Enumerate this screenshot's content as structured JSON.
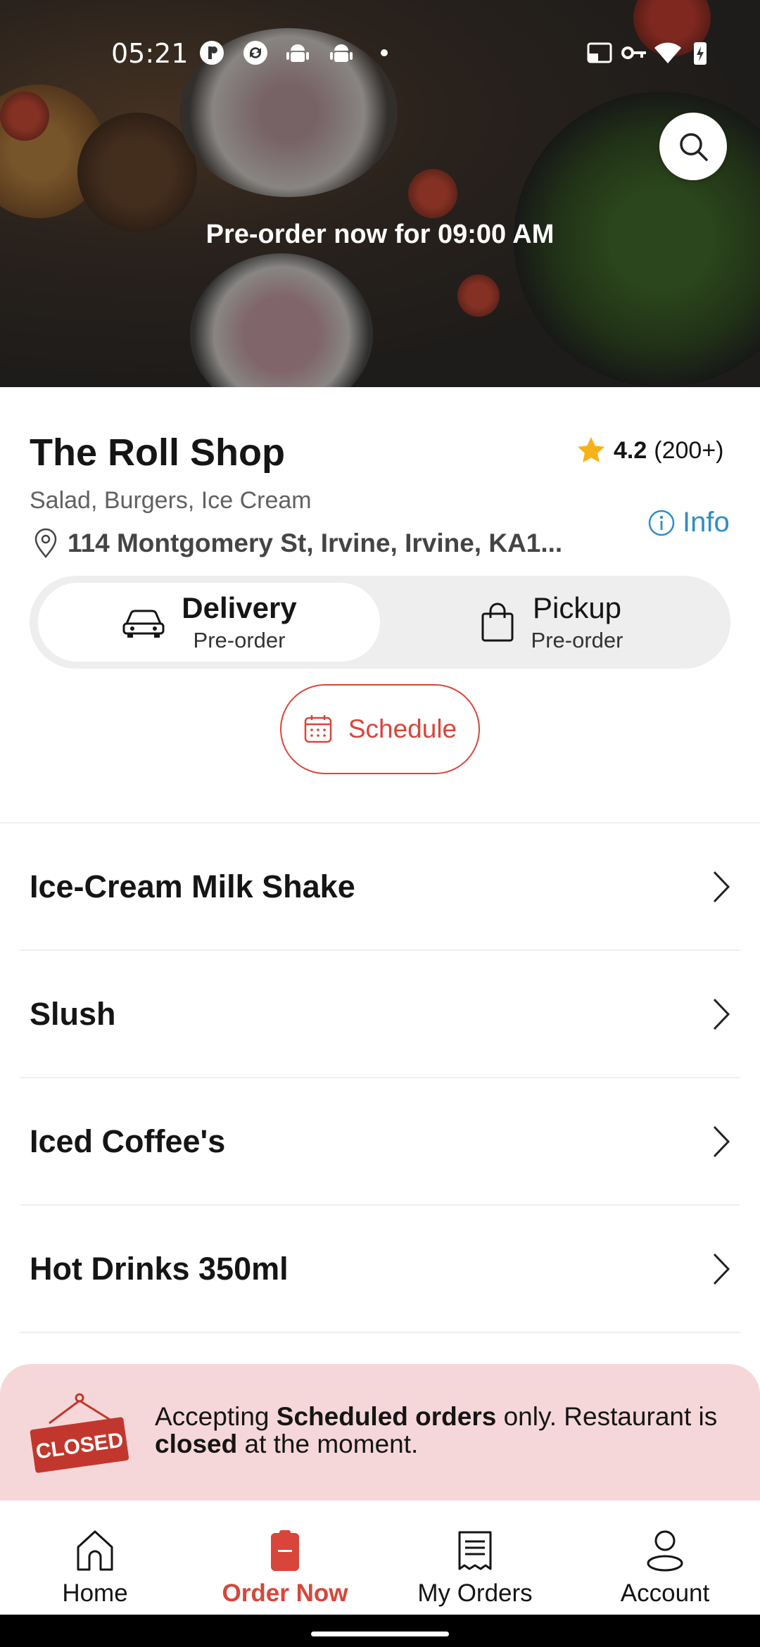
{
  "status_bar": {
    "time": "05:21"
  },
  "hero": {
    "preorder_text": "Pre-order now for 09:00 AM"
  },
  "restaurant": {
    "name": "The Roll Shop",
    "rating": "4.2",
    "rating_count": "(200+)",
    "cuisines": "Salad, Burgers, Ice Cream",
    "info_label": "Info",
    "address": "114 Montgomery St, Irvine, Irvine, KA1..."
  },
  "modes": {
    "delivery": {
      "title": "Delivery",
      "subtitle": "Pre-order"
    },
    "pickup": {
      "title": "Pickup",
      "subtitle": "Pre-order"
    }
  },
  "schedule_label": "Schedule",
  "categories": [
    {
      "label": "Ice-Cream Milk Shake"
    },
    {
      "label": "Slush"
    },
    {
      "label": "Iced Coffee's"
    },
    {
      "label": "Hot Drinks 350ml"
    }
  ],
  "closed_banner": {
    "sign_text": "CLOSED",
    "text_1": "Accepting ",
    "bold_1": "Scheduled orders",
    "text_2": " only. Restaurant is ",
    "bold_2": "closed",
    "text_3": " at the moment."
  },
  "nav": {
    "home": "Home",
    "order_now": "Order Now",
    "my_orders": "My Orders",
    "account": "Account"
  },
  "colors": {
    "accent": "#d9453a",
    "link": "#2d8ec7",
    "star": "#f5b31b",
    "banner_bg": "#f6d7d9"
  }
}
